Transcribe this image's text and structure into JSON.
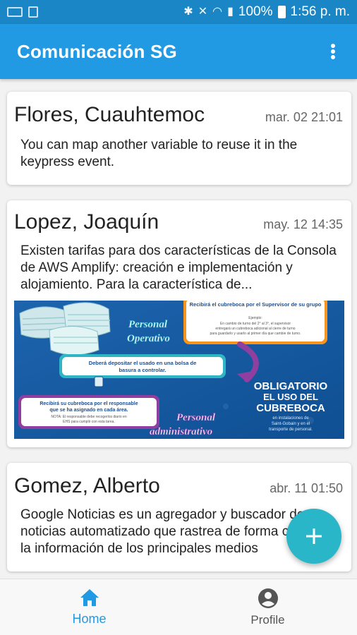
{
  "status_bar": {
    "battery_percent": "100%",
    "time": "1:56 p. m.",
    "icons": [
      "image-icon",
      "sim-icon",
      "bluetooth-icon",
      "mute-icon",
      "wifi-icon",
      "signal-icon",
      "battery-icon"
    ]
  },
  "app_bar": {
    "title": "Comunicación SG",
    "menu_icon": "more-vert-icon"
  },
  "messages": [
    {
      "author": "Flores, Cuauhtemoc",
      "date": "mar. 02 21:01",
      "text": "You can map another variable to reuse it in the keypress event."
    },
    {
      "author": "Lopez, Joaquín",
      "date": "may. 12 14:35",
      "text": "Existen tarifas para dos características de la Consola de AWS Amplify: creación e implementación y alojamiento. Para la característica de...",
      "poster": {
        "box_top": "Recibirá el cubreboca por el Supervisor de su grupo",
        "box_top_detail": "Ejemplo: En cambio de turno del 2° al 3°, el supervisor entregará un cubreboca adicional al cierre de turno para guardarlo y usarlo al primer día que cambie de turno.",
        "label_operativo": "Personal Operativo",
        "deposit": "Deberá depositar el usado en una bolsa de basura a controlar.",
        "obligatorio_1": "OBLIGATORIO",
        "obligatorio_2": "EL USO DEL",
        "obligatorio_3": "CUBREBOCA",
        "obligatorio_sub_1": "en instalaciones de",
        "obligatorio_sub_2": "Saint-Gobain y en el",
        "obligatorio_sub_3": "transporte de personal.",
        "box_bottom": "Recibirá su cubreboca por el responsable que se ha asignado en cada área.",
        "box_bottom_note": "NOTA: El responsable debe recogerlos diario en EHS para cumplir con esta tarea.",
        "label_admin": "Personal administrativo"
      }
    },
    {
      "author": "Gomez, Alberto",
      "date": "abr. 11 01:50",
      "text": "Google Noticias es un agregador y buscador de noticias automatizado que rastrea de forma constante la información de los principales medios"
    }
  ],
  "fab": {
    "icon": "plus-icon"
  },
  "bottom_nav": {
    "items": [
      {
        "label": "Home",
        "icon": "home-icon",
        "active": true
      },
      {
        "label": "Profile",
        "icon": "account-circle-icon",
        "active": false
      }
    ]
  },
  "colors": {
    "status_bar": "#1b86c6",
    "app_bar": "#2199e3",
    "fab": "#29b6c8",
    "active_nav": "#2199e3"
  }
}
